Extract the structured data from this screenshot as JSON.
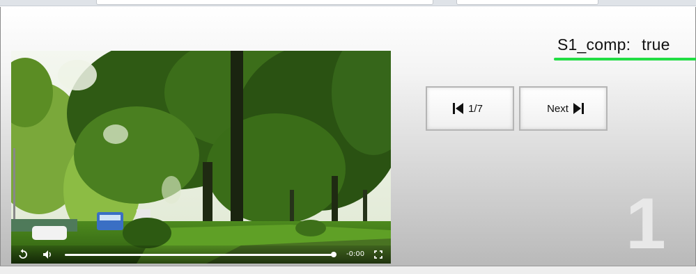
{
  "status": {
    "label": "S1_comp:",
    "value": "true"
  },
  "nav": {
    "prev_label": "1/7",
    "next_label": "Next"
  },
  "page_number": "1",
  "video": {
    "time_remaining": "-0:00",
    "progress_fraction": 1.0
  },
  "colors": {
    "underline": "#22dd44",
    "big_number": "#e8e8e8"
  },
  "icons": {
    "replay": "replay-icon",
    "volume": "volume-icon",
    "fullscreen": "fullscreen-icon",
    "skip_back": "skip-back-icon",
    "skip_forward": "skip-forward-icon"
  }
}
